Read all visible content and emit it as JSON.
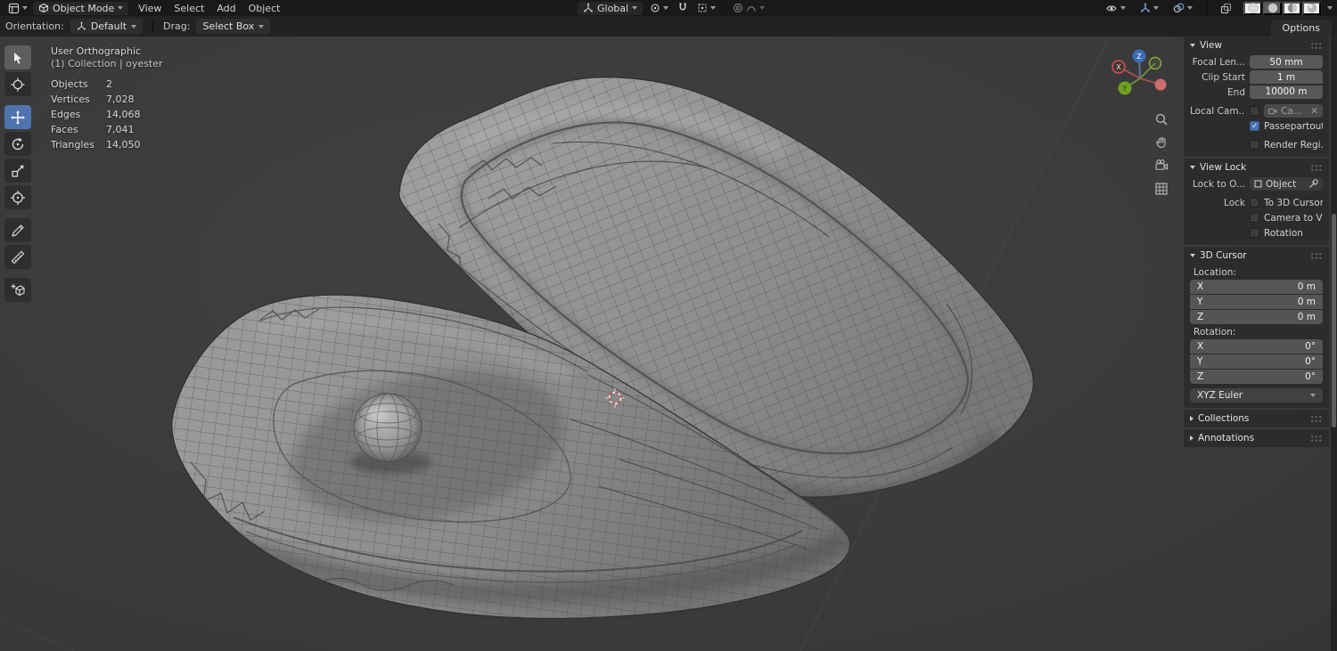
{
  "colors": {
    "accent": "#4772b3",
    "selected_tool": "#4f74ad",
    "axis_x": "#d24848",
    "axis_y": "#6fa21f",
    "axis_z": "#3d6bb5",
    "viewport_bg": "#3a3a3a",
    "panel_bg": "#2b2b2b",
    "field_bg": "#585858"
  },
  "icons": {
    "check": "✓",
    "close": "✕"
  },
  "topbar": {
    "mode_label": "Object Mode",
    "menus": [
      "View",
      "Select",
      "Add",
      "Object"
    ],
    "orientation_label": "Global"
  },
  "toolsettings": {
    "orientation_label": "Orientation:",
    "orientation_value": "Default",
    "drag_label": "Drag:",
    "drag_value": "Select Box",
    "options_tab": "Options"
  },
  "viewport": {
    "view_name": "User Orthographic",
    "context": "(1) Collection | oyester",
    "stats": [
      {
        "label": "Objects",
        "value": "2"
      },
      {
        "label": "Vertices",
        "value": "7,028"
      },
      {
        "label": "Edges",
        "value": "14,068"
      },
      {
        "label": "Faces",
        "value": "7,041"
      },
      {
        "label": "Triangles",
        "value": "14,050"
      }
    ],
    "gizmo": {
      "x": "X",
      "y": "Y",
      "z": "Z"
    }
  },
  "sidebar": {
    "view": {
      "title": "View",
      "focal_label": "Focal Len...",
      "focal_value": "50 mm",
      "clip_start_label": "Clip Start",
      "clip_start_value": "1 m",
      "clip_end_label": "End",
      "clip_end_value": "10000 m",
      "local_camera_label": "Local Cam...",
      "local_camera_value": "Ca...",
      "passepartout_label": "Passepartout",
      "passepartout_checked": true,
      "render_region_label": "Render Regi..."
    },
    "view_lock": {
      "title": "View Lock",
      "lock_to_label": "Lock to O...",
      "lock_to_value": "Object",
      "lock_label": "Lock",
      "check_1": "To 3D Cursor",
      "check_2": "Camera to Vi...",
      "check_3": "Rotation"
    },
    "cursor": {
      "title": "3D Cursor",
      "location_label": "Location:",
      "location": [
        {
          "axis": "X",
          "value": "0 m"
        },
        {
          "axis": "Y",
          "value": "0 m"
        },
        {
          "axis": "Z",
          "value": "0 m"
        }
      ],
      "rotation_label": "Rotation:",
      "rotation": [
        {
          "axis": "X",
          "value": "0°"
        },
        {
          "axis": "Y",
          "value": "0°"
        },
        {
          "axis": "Z",
          "value": "0°"
        }
      ],
      "rotation_mode": "XYZ Euler"
    },
    "collections_title": "Collections",
    "annotations_title": "Annotations"
  }
}
